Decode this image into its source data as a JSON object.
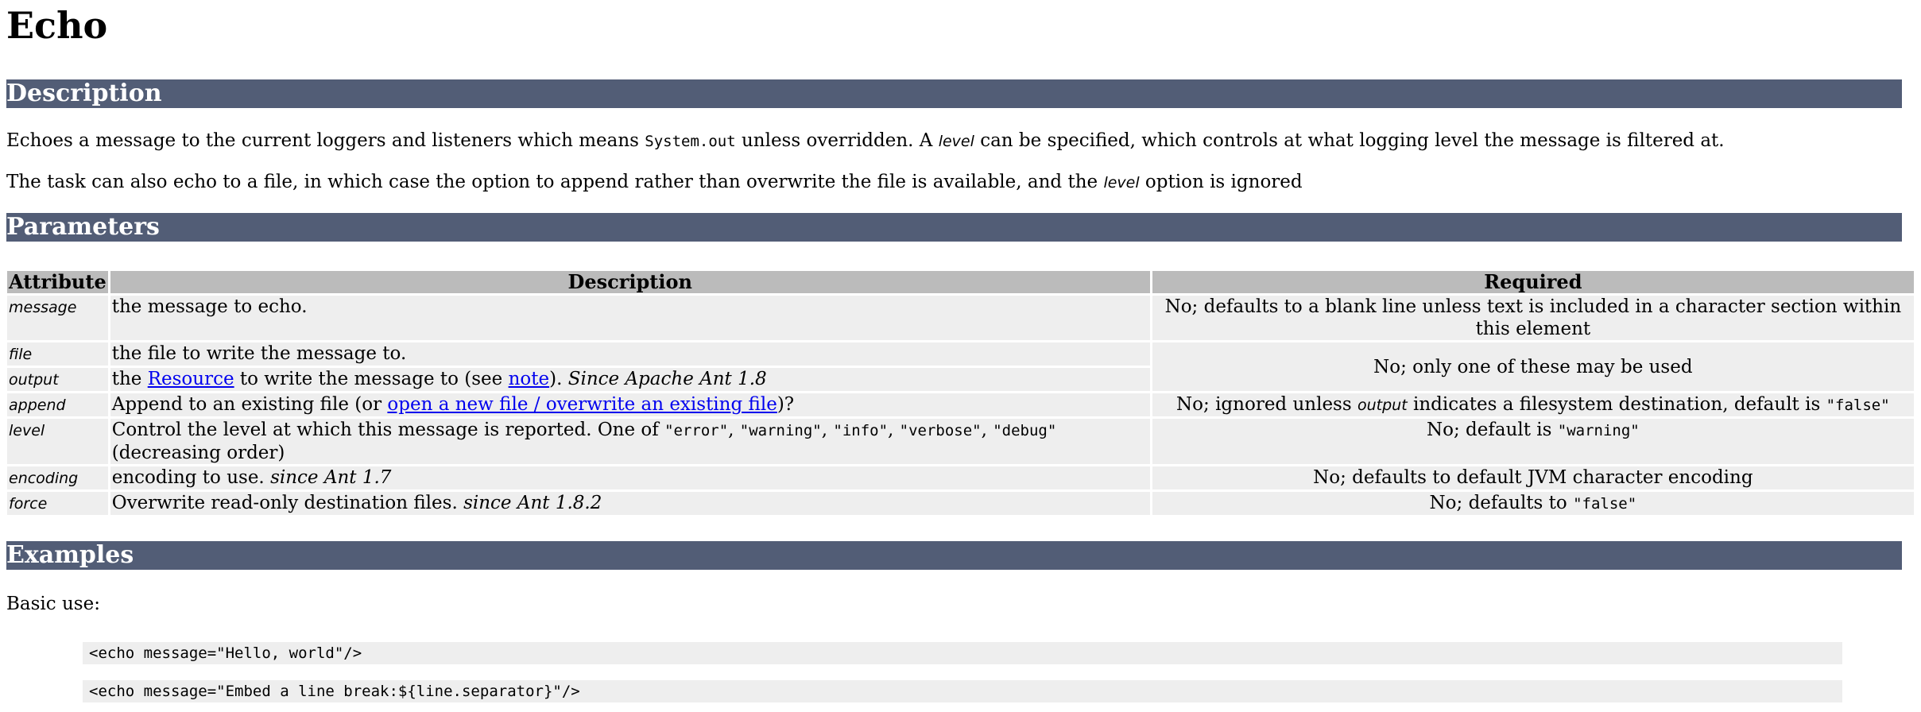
{
  "title": "Echo",
  "sections": {
    "description": "Description",
    "parameters": "Parameters",
    "examples": "Examples"
  },
  "description": {
    "p1_a": "Echoes a message to the current loggers and listeners which means ",
    "p1_code": "System.out",
    "p1_b": " unless overridden. A ",
    "p1_em": "level",
    "p1_c": " can be specified, which controls at what logging level the message is filtered at.",
    "p2_a": "The task can also echo to a file, in which case the option to append rather than overwrite the file is available, and the ",
    "p2_em": "level",
    "p2_b": " option is ignored"
  },
  "table": {
    "headers": [
      "Attribute",
      "Description",
      "Required"
    ],
    "rows": {
      "message": {
        "attr": "message",
        "desc": "the message to echo.",
        "req": "No; defaults to a blank line unless text is included in a character section within this element"
      },
      "file": {
        "attr": "file",
        "desc": "the file to write the message to."
      },
      "output": {
        "attr": "output",
        "desc_a": "the ",
        "desc_link1": "Resource",
        "desc_b": " to write the message to (see ",
        "desc_link2": "note",
        "desc_c": "). ",
        "desc_em": "Since Apache Ant 1.8"
      },
      "file_output_req": "No; only one of these may be used",
      "append": {
        "attr": "append",
        "desc_a": "Append to an existing file (or ",
        "desc_link": "open a new file / overwrite an existing file",
        "desc_b": ")?",
        "req_a": "No; ignored unless ",
        "req_em": "output",
        "req_b": " indicates a filesystem destination, default is ",
        "req_code": "\"false\""
      },
      "level": {
        "attr": "level",
        "desc_a": "Control the level at which this message is reported. One of ",
        "desc_c1": "\"error\"",
        "desc_sep1": ", ",
        "desc_c2": "\"warning\"",
        "desc_sep2": ", ",
        "desc_c3": "\"info\"",
        "desc_sep3": ", ",
        "desc_c4": "\"verbose\"",
        "desc_sep4": ", ",
        "desc_c5": "\"debug\"",
        "desc_b": " (decreasing order)",
        "req_a": "No; default is ",
        "req_code": "\"warning\""
      },
      "encoding": {
        "attr": "encoding",
        "desc_a": "encoding to use. ",
        "desc_em": "since Ant 1.7",
        "req": "No; defaults to default JVM character encoding"
      },
      "force": {
        "attr": "force",
        "desc_a": "Overwrite read-only destination files. ",
        "desc_em": "since Ant 1.8.2",
        "req_a": "No; defaults to ",
        "req_code": "\"false\""
      }
    }
  },
  "examples": {
    "basic_use": "Basic use:",
    "code1": "<echo message=\"Hello, world\"/>",
    "code2": "<echo message=\"Embed a line break:${line.separator}\"/>"
  }
}
